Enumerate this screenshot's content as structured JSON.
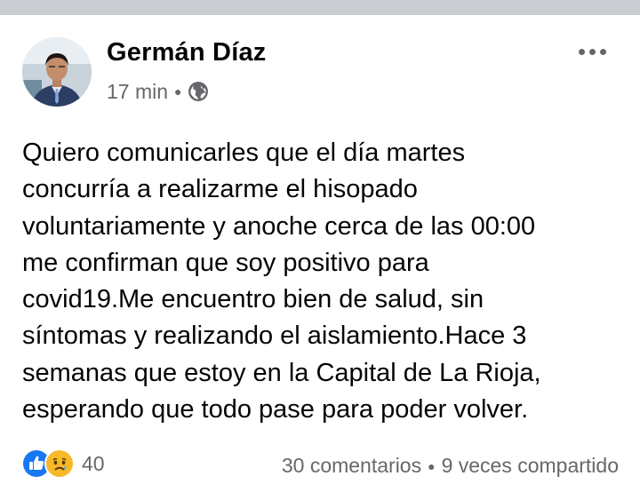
{
  "post": {
    "author_name": "Germán Díaz",
    "time": "17 min",
    "privacy_icon": "globe-icon",
    "more_icon": "more-options-icon",
    "text": "Quiero comunicarles que el día martes\nconcurría a realizarme el hisopado\nvoluntariamente y anoche cerca de las 00:00\nme confirman que soy positivo para\ncovid19.Me encuentro bien de salud, sin\nsíntomas y realizando el aislamiento.Hace 3\nsemanas que estoy en la Capital de La Rioja,\nesperando que todo pase para poder volver."
  },
  "footer": {
    "reaction_icons": [
      "like-icon",
      "sad-icon"
    ],
    "reaction_count": "40",
    "comments": "30 comentarios",
    "shares": "9 veces compartido"
  },
  "colors": {
    "text_primary": "#050505",
    "text_secondary": "#65676b",
    "like_blue": "#1877f2",
    "sad_yellow": "#f7b928",
    "divider": "#c9ccd1"
  }
}
